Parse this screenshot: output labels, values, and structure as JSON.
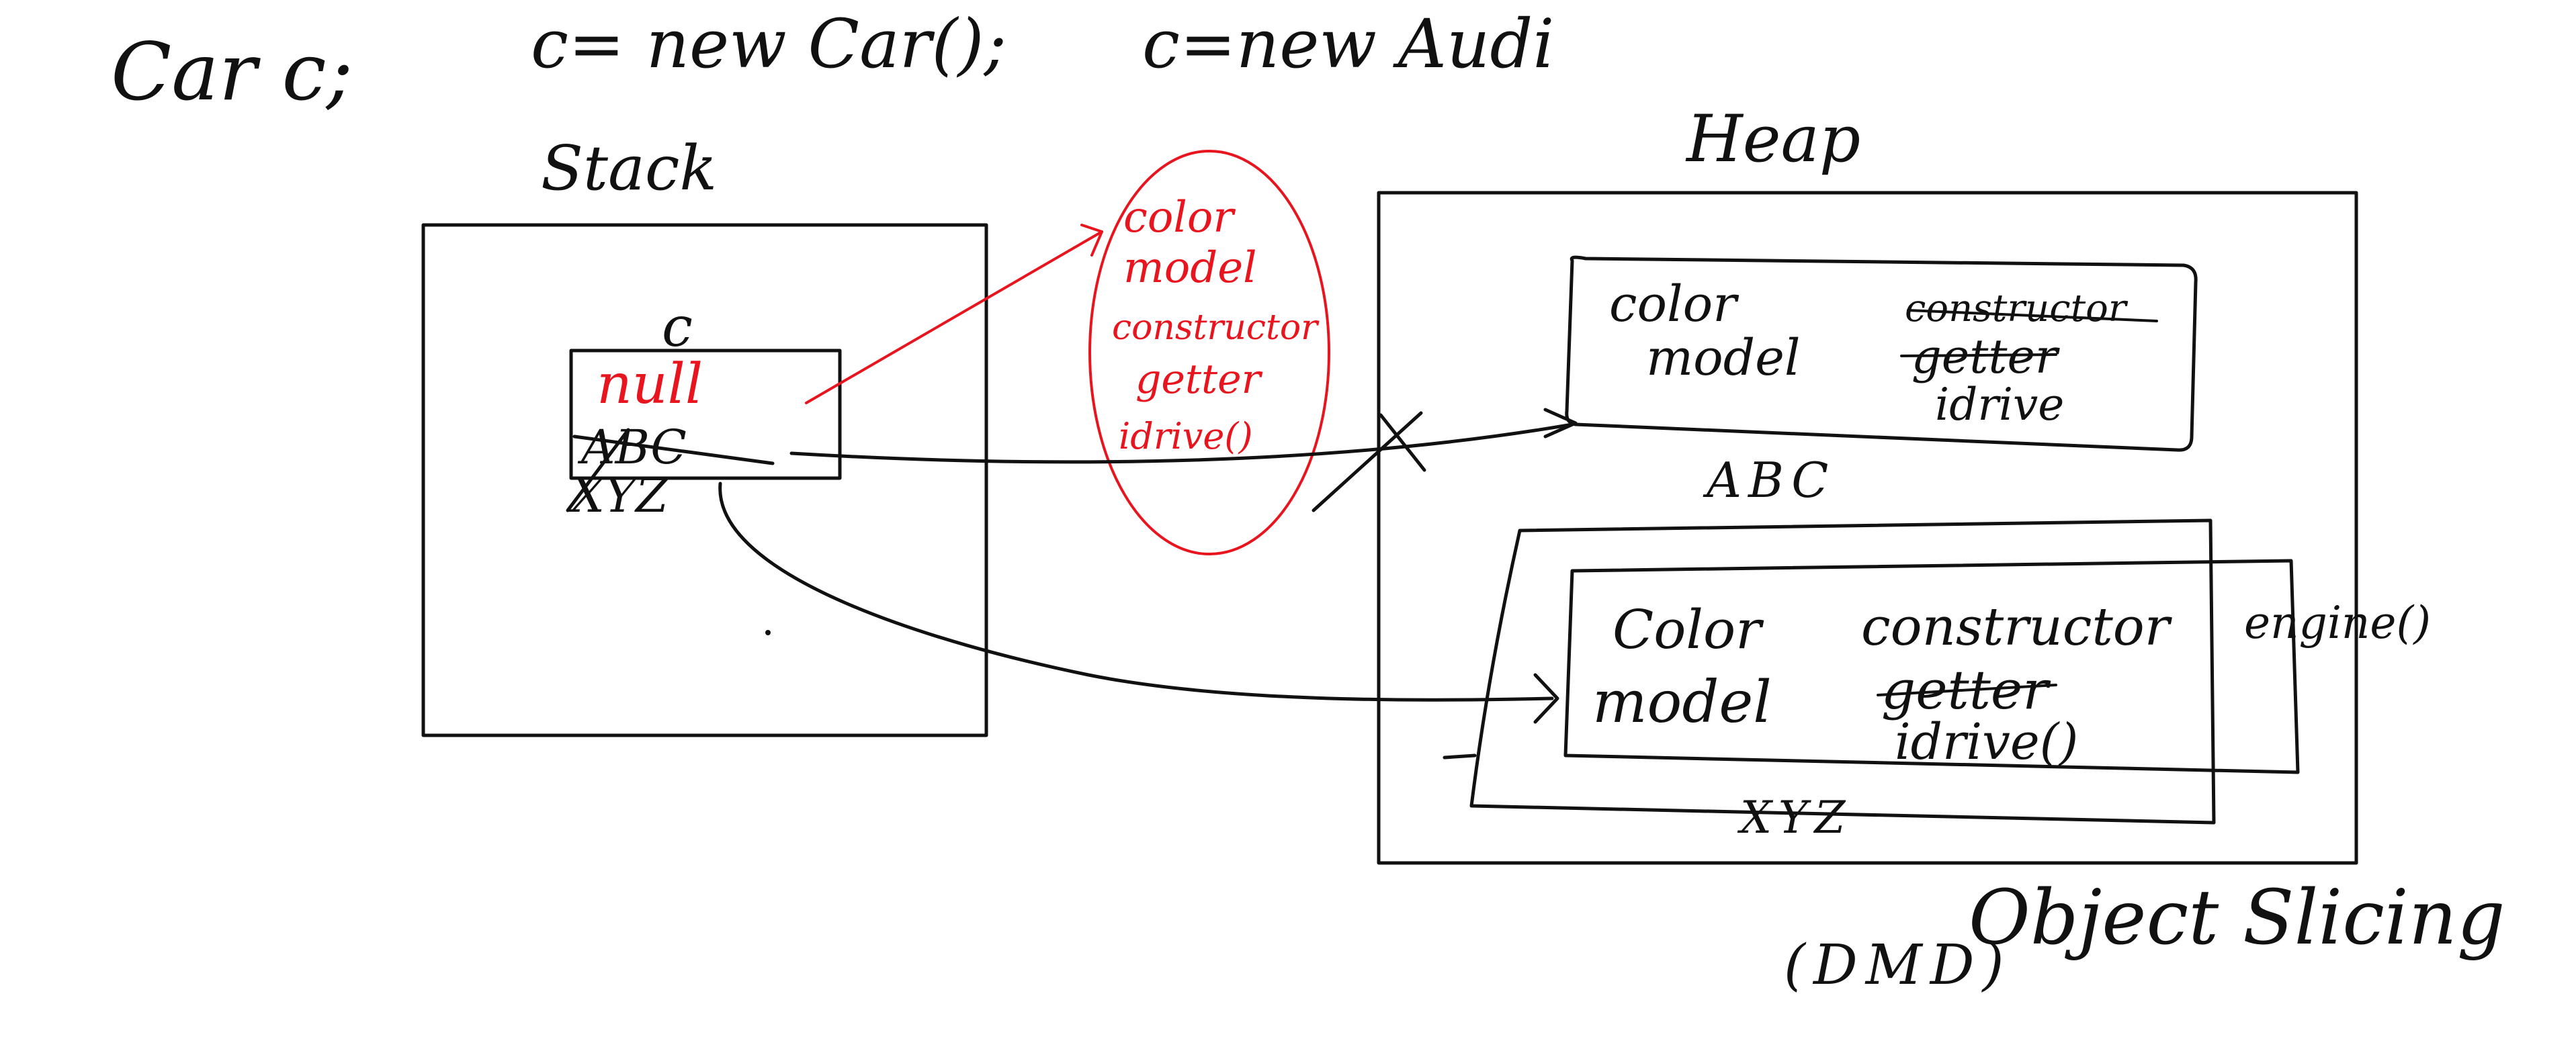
{
  "colors": {
    "background": "#ffffff",
    "ink_black": "#111111",
    "ink_red": "#e8141e"
  },
  "code_line": {
    "declaration": "Car c;",
    "assign_car": "c= new Car();",
    "assign_audi": "c=new Audi"
  },
  "stack": {
    "title": "Stack",
    "variable_name": "c",
    "value_current": "null",
    "value_abc": "ABC",
    "value_xyz": "XYZ"
  },
  "red_object": {
    "lines": [
      "color",
      "model",
      "constructor",
      "getter",
      "idrive()"
    ]
  },
  "heap": {
    "title": "Heap",
    "object_abc": {
      "fields": [
        "color",
        "model"
      ],
      "methods": [
        "constructor",
        "getter",
        "idrive"
      ],
      "address": "ABC"
    },
    "object_xyz": {
      "fields": [
        "Color",
        "model"
      ],
      "methods": [
        "constructor",
        "getter",
        "idrive()"
      ],
      "extra": "engine()",
      "address": "XYZ"
    }
  },
  "notes": {
    "slicing": "Object Slicing",
    "dmd": "(DMD)"
  }
}
